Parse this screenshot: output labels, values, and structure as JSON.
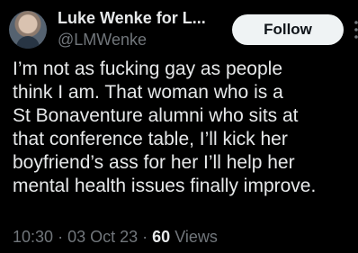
{
  "tweet": {
    "author": {
      "display_name": "Luke Wenke for L...",
      "handle": "@LMWenke"
    },
    "follow_label": "Follow",
    "text": "I’m not as fucking gay as people\nthink I am.  That woman who is a\nSt Bonaventure alumni who sits at\nthat conference table, I’ll kick her\nboyfriend’s ass for her I’ll help her\nmental health issues finally improve.",
    "time": "10:30",
    "separator": "·",
    "date": "03 Oct 23",
    "views_count": "60",
    "views_label": "Views"
  },
  "colors": {
    "background": "#000000",
    "text_primary": "#e7e9ea",
    "text_secondary": "#71767b",
    "follow_bg": "#eff3f4"
  },
  "icons": {
    "more": "more-vertical-icon"
  }
}
